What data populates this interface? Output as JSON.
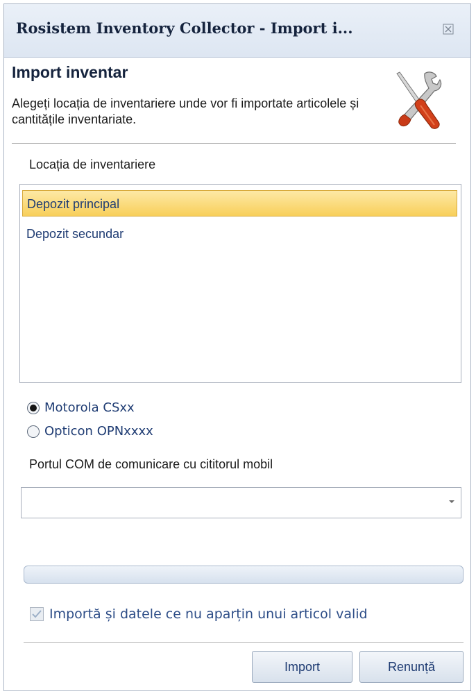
{
  "window": {
    "title": "Rosistem Inventory Collector - Import i..."
  },
  "header": {
    "title": "Import inventar",
    "description": "Alegeți locația de inventariere unde vor fi importate articolele și cantitățile inventariate.",
    "icon": "tools-icon"
  },
  "location": {
    "label": "Locația de inventariere",
    "items": [
      {
        "label": "Depozit principal",
        "selected": true
      },
      {
        "label": "Depozit secundar",
        "selected": false
      }
    ]
  },
  "device": {
    "options": [
      {
        "label": "Motorola CSxx",
        "checked": true
      },
      {
        "label": "Opticon OPNxxxx",
        "checked": false
      }
    ]
  },
  "com_port": {
    "label": "Portul COM de comunicare cu cititorul mobil",
    "value": ""
  },
  "progress": {
    "value": 0
  },
  "options": {
    "import_invalid_label": "Importă și datele ce nu aparțin unui articol valid",
    "import_invalid_checked": true
  },
  "buttons": {
    "import_label": "Import",
    "cancel_label": "Renunță"
  }
}
